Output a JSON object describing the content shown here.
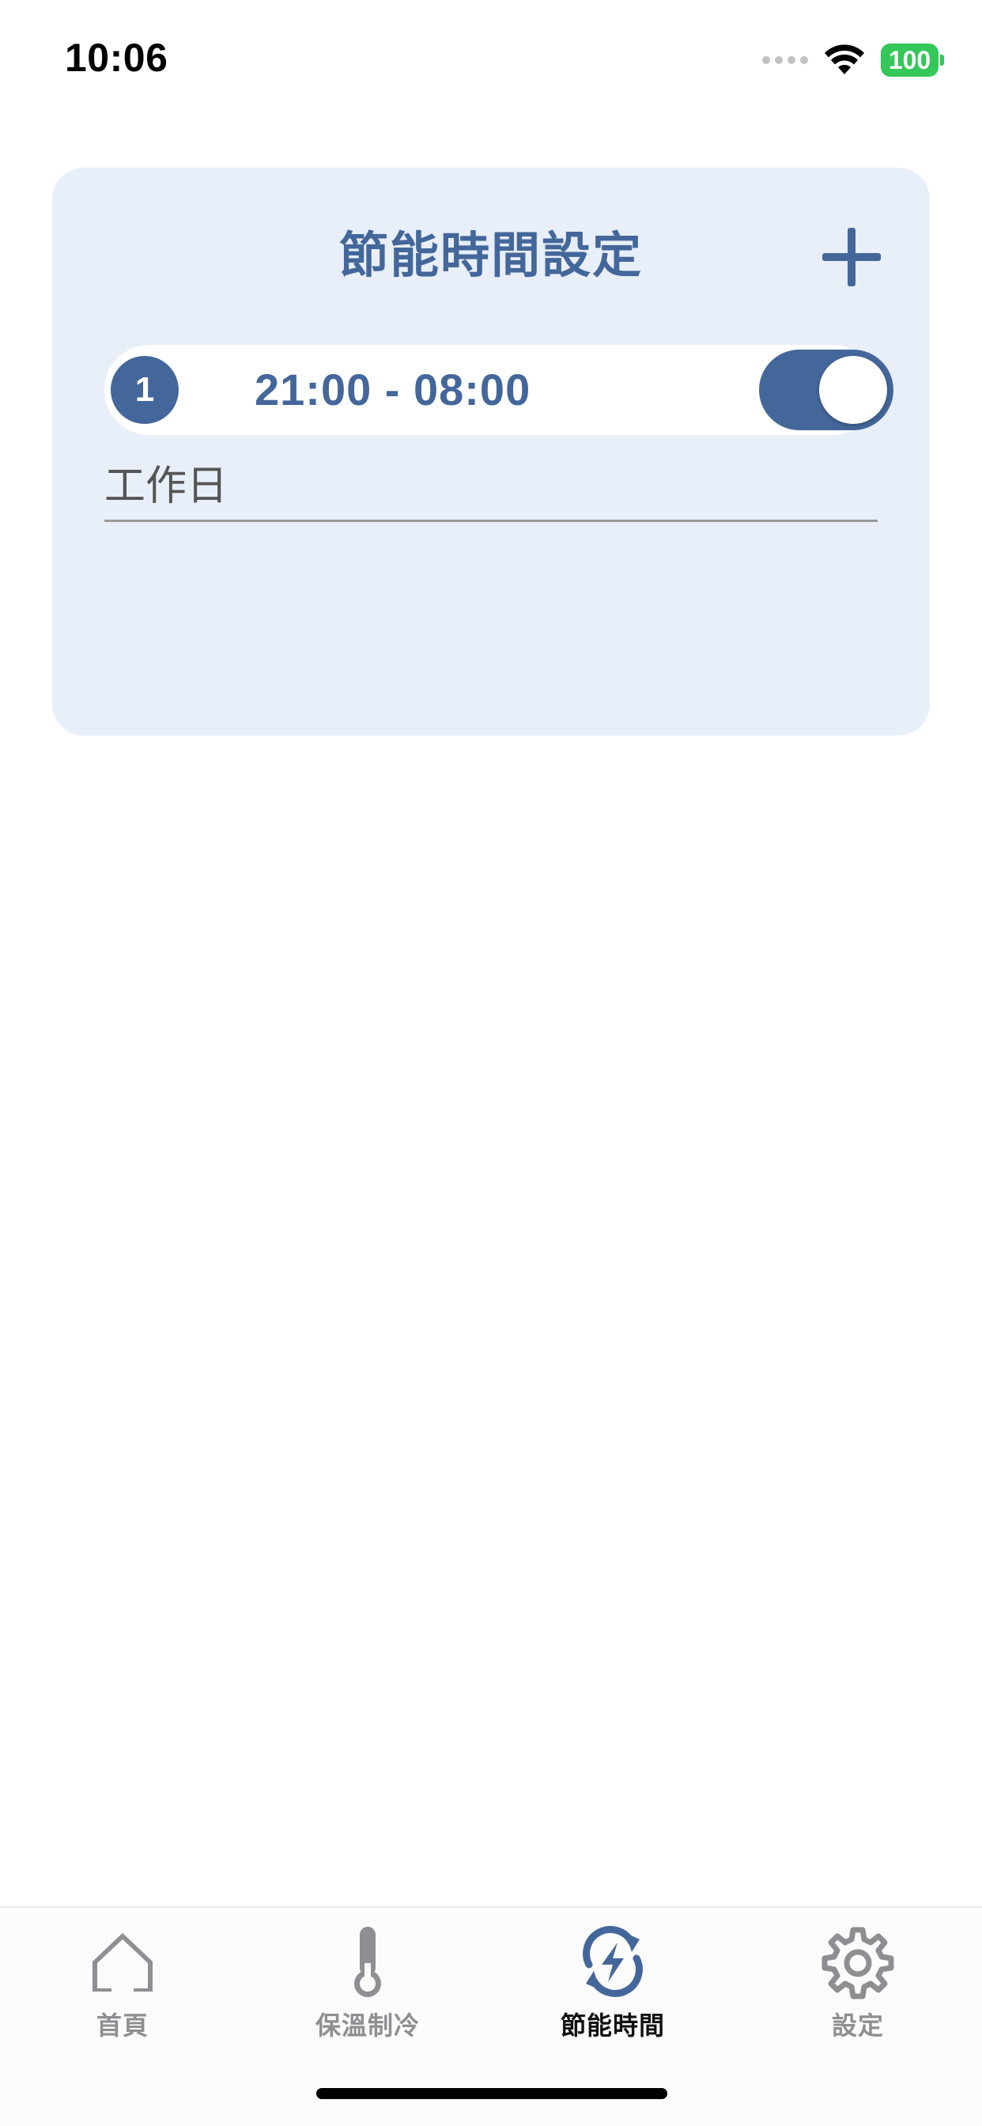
{
  "status_bar": {
    "time": "10:06",
    "battery_level": "100"
  },
  "card": {
    "title": "節能時間設定",
    "add_icon": "plus-icon",
    "schedules": [
      {
        "index": "1",
        "time_range": "21:00 - 08:00",
        "enabled": true,
        "days": "工作日"
      }
    ]
  },
  "tab_bar": {
    "tabs": [
      {
        "label": "首頁",
        "icon": "home-icon",
        "active": false
      },
      {
        "label": "保溫制冷",
        "icon": "thermometer-icon",
        "active": false
      },
      {
        "label": "節能時間",
        "icon": "energy-cycle-icon",
        "active": true
      },
      {
        "label": "設定",
        "icon": "gear-icon",
        "active": false
      }
    ]
  },
  "colors": {
    "accent": "#44679b",
    "card_background": "#e8eff9",
    "battery": "#34c759",
    "inactive_tab": "#8e8e93"
  }
}
